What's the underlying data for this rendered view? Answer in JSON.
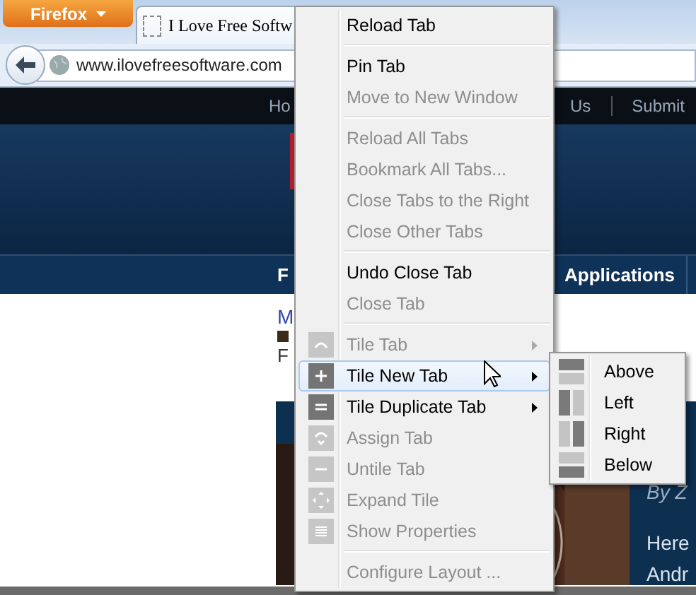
{
  "browser": {
    "app_button": "Firefox",
    "tab_title": "I Love Free Softw",
    "address": "www.ilovefreesoftware.com"
  },
  "page": {
    "top_nav": [
      "Ho",
      "Us",
      "Submit"
    ],
    "category_nav": [
      "F",
      "Applications"
    ],
    "article_title": "M",
    "article_meta": "F",
    "sidebar_byline": "By Z",
    "sidebar_lines": [
      "Here",
      "Andr"
    ]
  },
  "context_menu": {
    "items": [
      {
        "kind": "command",
        "label": "Reload Tab",
        "disabled": false,
        "selected": false,
        "has_submenu": false
      },
      {
        "kind": "separator"
      },
      {
        "kind": "command",
        "label": "Pin Tab",
        "disabled": false,
        "selected": false,
        "has_submenu": false
      },
      {
        "kind": "command",
        "label": "Move to New Window",
        "disabled": true,
        "selected": false,
        "has_submenu": false
      },
      {
        "kind": "separator"
      },
      {
        "kind": "command",
        "label": "Reload All Tabs",
        "disabled": true,
        "selected": false,
        "has_submenu": false
      },
      {
        "kind": "command",
        "label": "Bookmark All Tabs...",
        "disabled": true,
        "selected": false,
        "has_submenu": false
      },
      {
        "kind": "command",
        "label": "Close Tabs to the Right",
        "disabled": true,
        "selected": false,
        "has_submenu": false
      },
      {
        "kind": "command",
        "label": "Close Other Tabs",
        "disabled": true,
        "selected": false,
        "has_submenu": false
      },
      {
        "kind": "separator"
      },
      {
        "kind": "command",
        "label": "Undo Close Tab",
        "disabled": false,
        "selected": false,
        "has_submenu": false
      },
      {
        "kind": "command",
        "label": "Close Tab",
        "disabled": true,
        "selected": false,
        "has_submenu": false
      },
      {
        "kind": "separator"
      },
      {
        "kind": "tile",
        "label": "Tile Tab",
        "disabled": true,
        "selected": false,
        "has_submenu": true
      },
      {
        "kind": "tile",
        "label": "Tile New Tab",
        "disabled": false,
        "selected": true,
        "has_submenu": true
      },
      {
        "kind": "tile",
        "label": "Tile Duplicate Tab",
        "disabled": false,
        "selected": false,
        "has_submenu": true
      },
      {
        "kind": "tile",
        "label": "Assign Tab",
        "disabled": true,
        "selected": false,
        "has_submenu": false
      },
      {
        "kind": "tile",
        "label": "Untile Tab",
        "disabled": true,
        "selected": false,
        "has_submenu": false
      },
      {
        "kind": "tile",
        "label": "Expand Tile",
        "disabled": true,
        "selected": false,
        "has_submenu": false
      },
      {
        "kind": "tile",
        "label": "Show Properties",
        "disabled": true,
        "selected": false,
        "has_submenu": false
      },
      {
        "kind": "separator"
      },
      {
        "kind": "command",
        "label": "Configure Layout ...",
        "disabled": true,
        "selected": false,
        "has_submenu": false
      }
    ]
  },
  "submenu": {
    "items": [
      {
        "label": "Above"
      },
      {
        "label": "Left"
      },
      {
        "label": "Right"
      },
      {
        "label": "Below"
      }
    ]
  }
}
